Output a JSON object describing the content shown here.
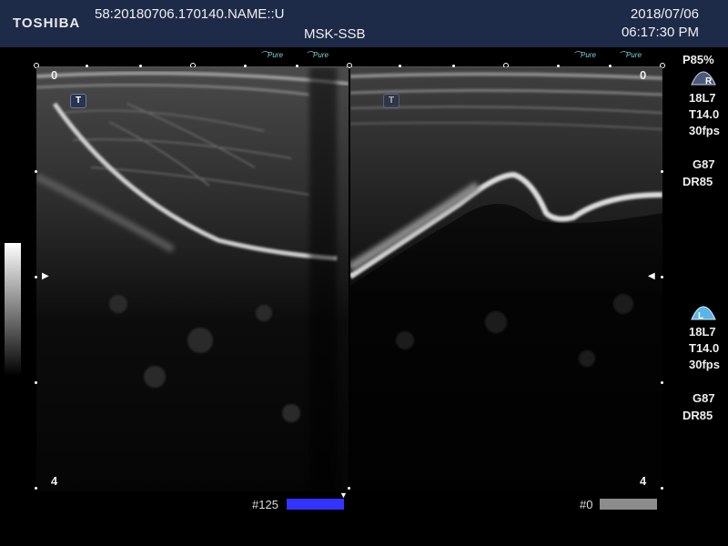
{
  "header": {
    "brand": "TOSHIBA",
    "patient_id": "58:20180706.170140.NAME::U",
    "preset": "MSK-SSB",
    "date": "2018/07/06",
    "time": "06:17:30 PM"
  },
  "overlays": {
    "pure_label_1": "Pure",
    "pure_label_2": "Pure",
    "pure_label_3": "Pure",
    "pure_label_4": "Pure",
    "depth_left_top": "0",
    "depth_left_bottom": "4",
    "depth_right_top": "0",
    "depth_right_bottom": "4",
    "probe_left": "T",
    "probe_right": "T"
  },
  "params_top": {
    "power": "P85%",
    "icon_letter": "R",
    "probe": "18L7",
    "thermal": "T14.0",
    "fps": "30fps",
    "gain": "G87",
    "dr": "DR85"
  },
  "params_bottom": {
    "icon_letter": "L",
    "probe": "18L7",
    "thermal": "T14.0",
    "fps": "30fps",
    "gain": "G87",
    "dr": "DR85"
  },
  "footer": {
    "left_frame": "#125",
    "left_bar_color": "#3333ff",
    "right_frame": "#0",
    "right_bar_color": "#8c8c8c"
  }
}
